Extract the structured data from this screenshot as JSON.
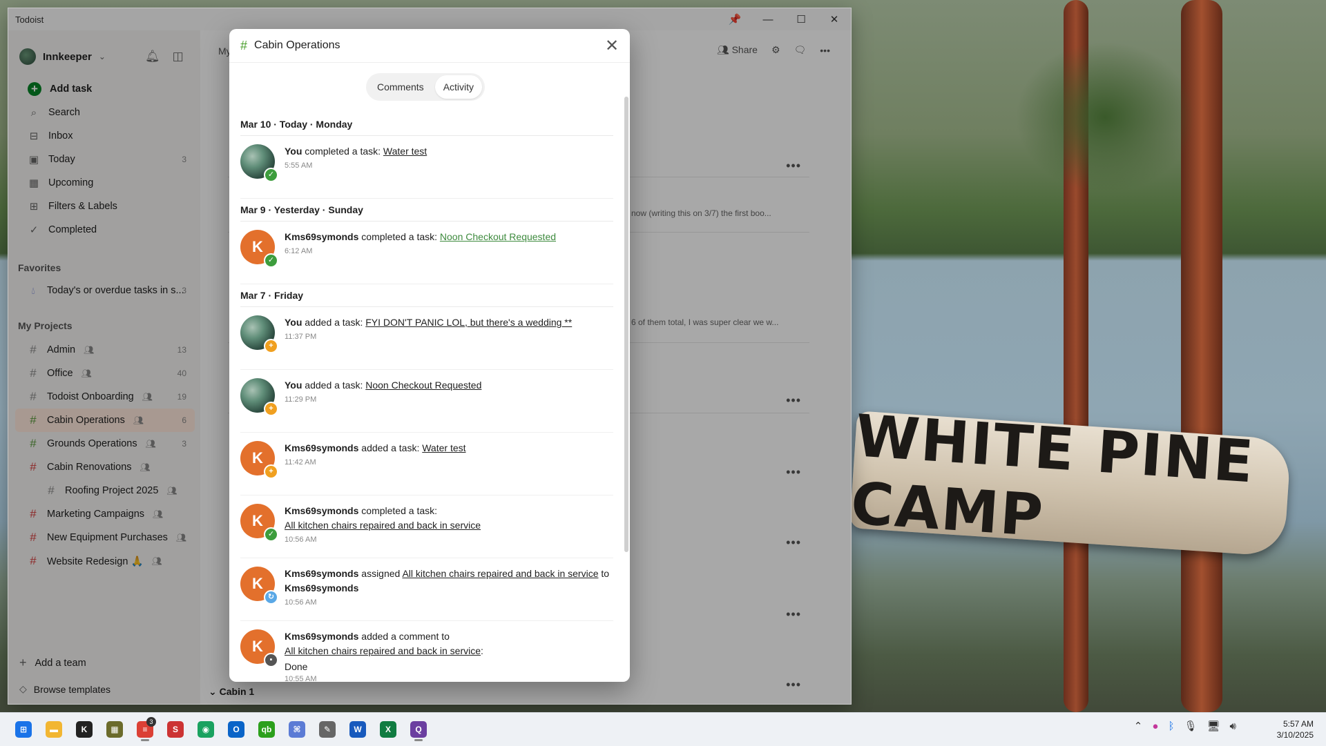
{
  "window": {
    "title": "Todoist"
  },
  "sidebar": {
    "user": "Innkeeper",
    "nav": [
      {
        "label": "Add task",
        "icon": "plus-circle-icon"
      },
      {
        "label": "Search",
        "icon": "search-icon"
      },
      {
        "label": "Inbox",
        "icon": "inbox-icon"
      },
      {
        "label": "Today",
        "icon": "calendar-today-icon",
        "count": "3"
      },
      {
        "label": "Upcoming",
        "icon": "calendar-grid-icon"
      },
      {
        "label": "Filters & Labels",
        "icon": "grid-icon"
      },
      {
        "label": "Completed",
        "icon": "check-circle-icon"
      }
    ],
    "favorites_heading": "Favorites",
    "favorites": [
      {
        "label": "Today's or overdue tasks in s...",
        "count": "3"
      }
    ],
    "projects_heading": "My Projects",
    "projects": [
      {
        "label": "Admin",
        "count": "13",
        "color": "#8a8a8a"
      },
      {
        "label": "Office",
        "count": "40",
        "color": "#8a8a8a"
      },
      {
        "label": "Todoist Onboarding",
        "count": "19",
        "color": "#8a8a8a"
      },
      {
        "label": "Cabin Operations",
        "count": "6",
        "color": "#5a9a3d"
      },
      {
        "label": "Grounds Operations",
        "count": "3",
        "color": "#5a9a3d"
      },
      {
        "label": "Cabin Renovations",
        "count": "",
        "color": "#d64040"
      },
      {
        "label": "Roofing Project 2025",
        "count": "",
        "color": "#8a8a8a"
      },
      {
        "label": "Marketing Campaigns",
        "count": "",
        "color": "#d64040"
      },
      {
        "label": "New Equipment Purchases",
        "count": "",
        "color": "#d64040"
      },
      {
        "label": "Website Redesign 🙏",
        "count": "",
        "color": "#d64040"
      }
    ],
    "add_team": "Add a team",
    "browse_templates": "Browse templates"
  },
  "main": {
    "breadcrumb": "My P",
    "share_label": "Share",
    "snippet1": "now (writing this on 3/7) the first boo...",
    "snippet2": "6 of them total, I was super clear we w...",
    "section_label": "Cabin 1"
  },
  "modal": {
    "title": "Cabin Operations",
    "tabs": [
      "Comments",
      "Activity"
    ],
    "active_tab": "Activity",
    "days": [
      {
        "heading": "Mar 10 · Today · Monday",
        "events": [
          {
            "actor": "You",
            "avatar": "photo",
            "badge": "done",
            "action": "completed a task:",
            "target": "Water test",
            "time": "5:55 AM"
          }
        ]
      },
      {
        "heading": "Mar 9 · Yesterday · Sunday",
        "events": [
          {
            "actor": "Kms69symonds",
            "avatar": "K",
            "badge": "done",
            "action": "completed a task:",
            "target": "Noon Checkout Requested",
            "target_green": true,
            "time": "6:12 AM"
          }
        ]
      },
      {
        "heading": "Mar 7 · Friday",
        "events": [
          {
            "actor": "You",
            "avatar": "photo",
            "badge": "add",
            "action": "added a task:",
            "target": "FYI DON'T PANIC LOL, but there's a wedding **",
            "time": "11:37 PM"
          },
          {
            "actor": "You",
            "avatar": "photo",
            "badge": "add",
            "action": "added a task:",
            "target": "Noon Checkout Requested",
            "time": "11:29 PM"
          },
          {
            "actor": "Kms69symonds",
            "avatar": "K",
            "badge": "add",
            "action": "added a task:",
            "target": "Water test",
            "time": "11:42 AM"
          },
          {
            "actor": "Kms69symonds",
            "avatar": "K",
            "badge": "done",
            "action": "completed a task:",
            "target": "All kitchen chairs repaired and back in service",
            "time": "10:56 AM",
            "wrap": true
          },
          {
            "actor": "Kms69symonds",
            "avatar": "K",
            "badge": "assign",
            "action": "assigned",
            "target": "All kitchen chairs repaired and back in service",
            "suffix": "to",
            "assignee": "Kms69symonds",
            "time": "10:56 AM"
          },
          {
            "actor": "Kms69symonds",
            "avatar": "K",
            "badge": "comment",
            "action": "added a comment to",
            "target": "All kitchen chairs repaired and back in service",
            "target_suffix": ":",
            "body": "Done",
            "time": "10:55 AM",
            "wrap": true
          },
          {
            "actor": "Kms69symonds",
            "avatar": "K",
            "badge": "add",
            "action": "added a task:",
            "target": "All kitchen chairs repaired and back in service",
            "time": ""
          }
        ]
      }
    ]
  },
  "wallpaper": {
    "sign_text": "WHITE PINE CAMP"
  },
  "taskbar": {
    "apps": [
      {
        "name": "start-button",
        "glyph": "⊞",
        "color": "#1a73e8"
      },
      {
        "name": "file-explorer",
        "glyph": "▬",
        "color": "#f2b632"
      },
      {
        "name": "app-k",
        "glyph": "K",
        "color": "#222"
      },
      {
        "name": "app-calculator",
        "glyph": "▦",
        "color": "#6b6b2b"
      },
      {
        "name": "todoist-app",
        "glyph": "≡",
        "color": "#db4035",
        "badge": "3",
        "running": true
      },
      {
        "name": "app-red",
        "glyph": "S",
        "color": "#c33"
      },
      {
        "name": "chrome",
        "glyph": "◉",
        "color": "#1aa260"
      },
      {
        "name": "outlook",
        "glyph": "O",
        "color": "#0a64c8"
      },
      {
        "name": "quickbooks",
        "glyph": "qb",
        "color": "#2ca01c"
      },
      {
        "name": "app-network",
        "glyph": "⌘",
        "color": "#5b7bd5"
      },
      {
        "name": "app-tools",
        "glyph": "✎",
        "color": "#666"
      },
      {
        "name": "word",
        "glyph": "W",
        "color": "#185abd"
      },
      {
        "name": "excel",
        "glyph": "X",
        "color": "#107c41"
      },
      {
        "name": "app-purple",
        "glyph": "Q",
        "color": "#6b3fa0",
        "running": true
      }
    ],
    "time": "5:57 AM",
    "date": "3/10/2025"
  }
}
